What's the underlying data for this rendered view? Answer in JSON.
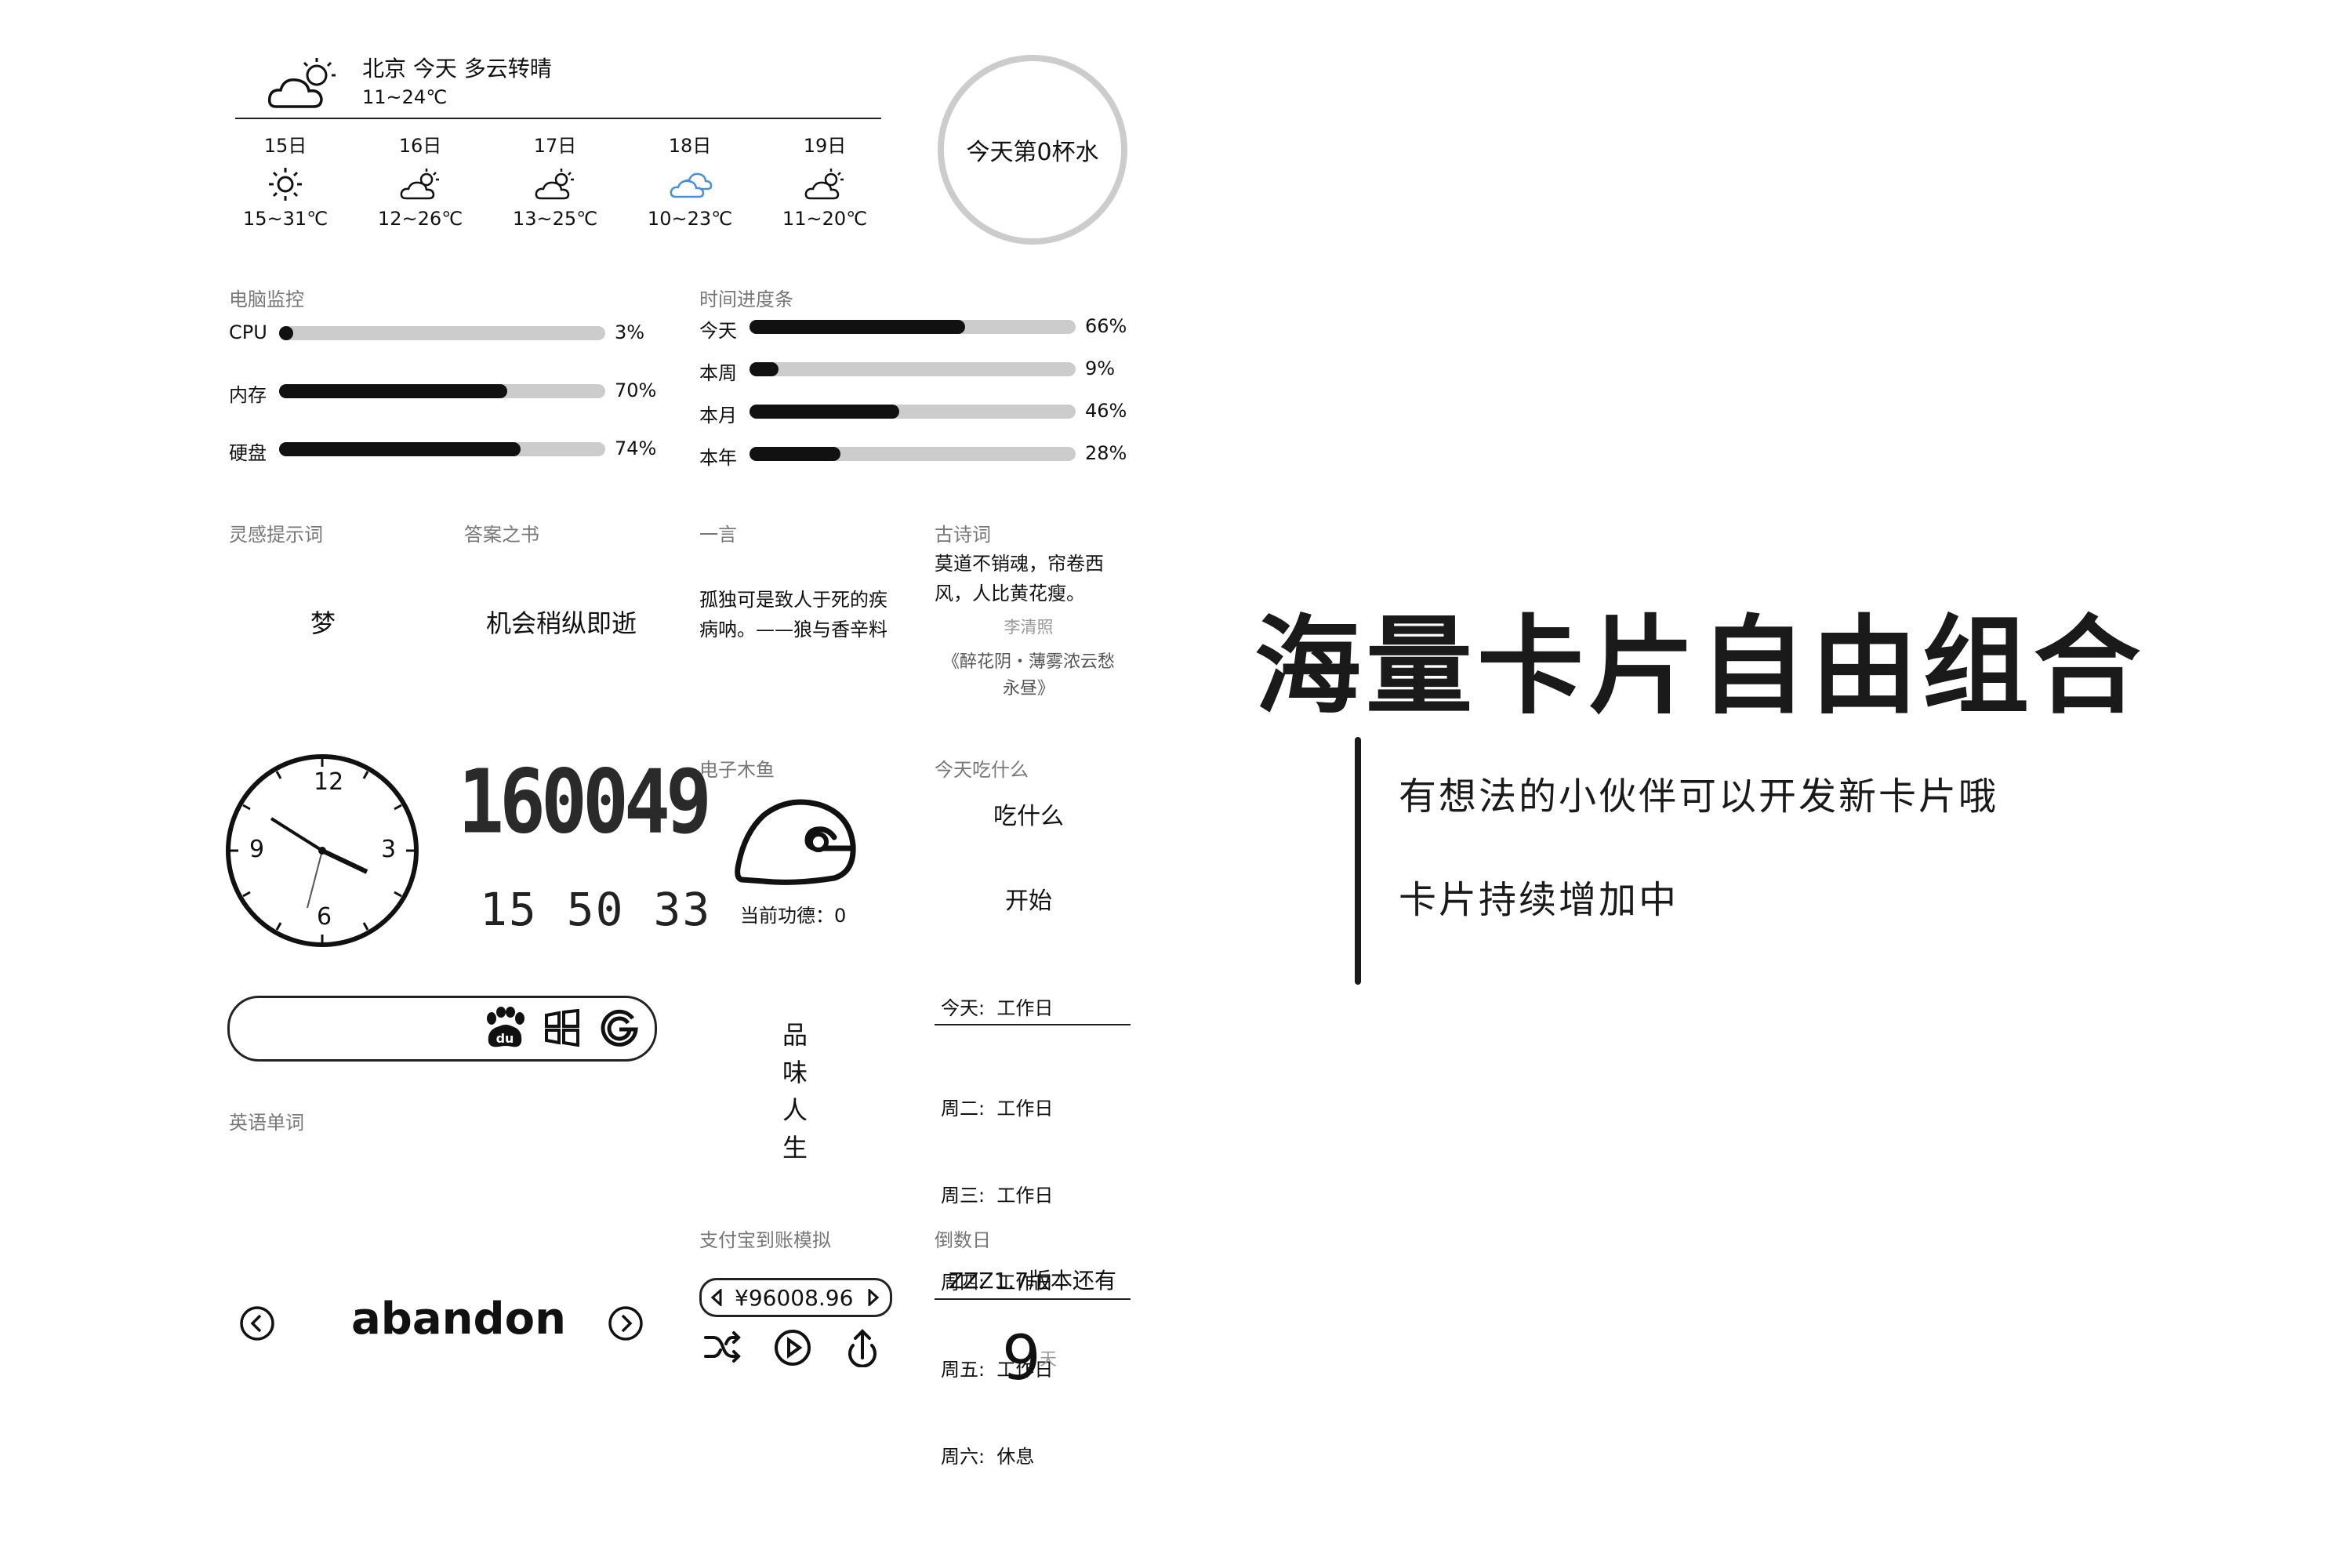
{
  "weather": {
    "title": "北京 今天 多云转晴",
    "range": "11~24℃",
    "days": [
      {
        "date": "15日",
        "icon": "sun-icon",
        "temp": "15~31℃"
      },
      {
        "date": "16日",
        "icon": "partly-cloudy-icon",
        "temp": "12~26℃"
      },
      {
        "date": "17日",
        "icon": "partly-cloudy-icon",
        "temp": "13~25℃"
      },
      {
        "date": "18日",
        "icon": "cloud-icon",
        "temp": "10~23℃"
      },
      {
        "date": "19日",
        "icon": "partly-cloudy-icon",
        "temp": "11~20℃"
      }
    ]
  },
  "water": {
    "text": "今天第0杯水"
  },
  "monitor": {
    "title": "电脑监控",
    "rows": [
      {
        "name": "CPU",
        "value": 3,
        "label": "3%"
      },
      {
        "name": "内存",
        "value": 70,
        "label": "70%"
      },
      {
        "name": "硬盘",
        "value": 74,
        "label": "74%"
      }
    ]
  },
  "time_progress": {
    "title": "时间进度条",
    "rows": [
      {
        "name": "今天",
        "value": 66,
        "label": "66%"
      },
      {
        "name": "本周",
        "value": 9,
        "label": "9%"
      },
      {
        "name": "本月",
        "value": 46,
        "label": "46%"
      },
      {
        "name": "本年",
        "value": 28,
        "label": "28%"
      }
    ]
  },
  "inspiration": {
    "title": "灵感提示词",
    "word": "梦"
  },
  "answer_book": {
    "title": "答案之书",
    "answer": "机会稍纵即逝"
  },
  "hitokoto": {
    "title": "一言",
    "text": "孤独可是致人于死的疾病呐。——狼与香辛料"
  },
  "poem": {
    "title": "古诗词",
    "text": "莫道不销魂，帘卷西风，人比黄花瘦。",
    "author": "李清照",
    "source": "《醉花阴・薄雾浓云愁永昼》"
  },
  "digital_time": {
    "big": "160049",
    "small": "15 50 33"
  },
  "clock": {
    "h12": "12",
    "h3": "3",
    "h6": "6",
    "h9": "9"
  },
  "wooden_fish": {
    "title": "电子木鱼",
    "merit": "当前功德：0"
  },
  "what_to_eat": {
    "title": "今天吃什么",
    "question": "吃什么",
    "start": "开始"
  },
  "search": {
    "engines": [
      "baidu-icon",
      "windows-icon",
      "google-icon"
    ]
  },
  "savor": {
    "chars": [
      "品",
      "味",
      "人",
      "生"
    ]
  },
  "workdays": {
    "today": "今天:  工作日",
    "days": [
      "周二:  工作日",
      "周三:  工作日",
      "周四:  工作日",
      "周五:  工作日",
      "周六:  休息"
    ]
  },
  "english": {
    "title": "英语单词",
    "word": "abandon"
  },
  "alipay": {
    "title": "支付宝到账模拟",
    "amount": "¥96008.96"
  },
  "countdown": {
    "title": "倒数日",
    "event": "ZZZ1.7版本还有",
    "days": "9",
    "unit": "天"
  },
  "promo": {
    "headline": "海量卡片自由组合",
    "line1": "有想法的小伙伴可以开发新卡片哦",
    "line2": "卡片持续增加中"
  },
  "colors": {
    "accent_blue": "#4a90d9",
    "bar_track": "#cccccc",
    "ring": "#cccccc"
  }
}
